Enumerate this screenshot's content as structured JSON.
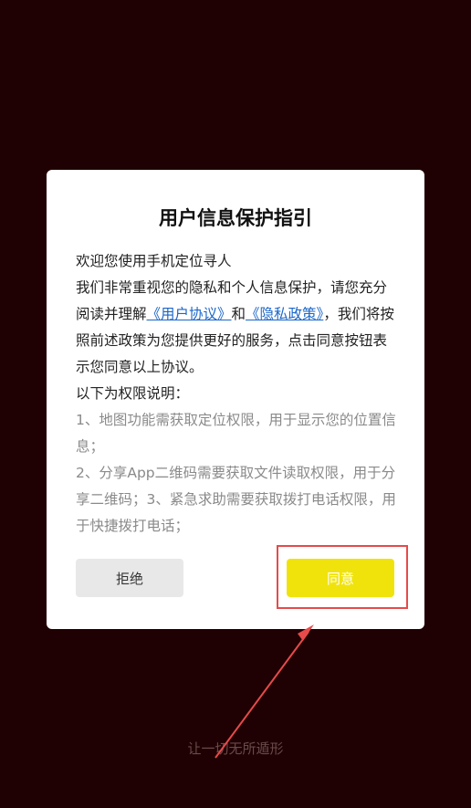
{
  "dialog": {
    "title": "用户信息保护指引",
    "intro": "欢迎您使用手机定位寻人",
    "body_part1": "我们非常重视您的隐私和个人信息保护，请您充分阅读并理解",
    "link_user_agreement": "《用户协议》",
    "and_text": "和",
    "link_privacy_policy": "《隐私政策》",
    "body_part2": "，我们将按照前述政策为您提供更好的服务，点击同意按钮表示您同意以上协议。",
    "permissions_heading": "以下为权限说明：",
    "permission_1": "1、地图功能需获取定位权限，用于显示您的位置信息；",
    "permission_2_3": "2、分享App二维码需要获取文件读取权限，用于分享二维码；3、紧急求助需要获取拨打电话权限，用于快捷拨打电话；",
    "reject_label": "拒绝",
    "agree_label": "同意"
  },
  "slogan": "让一切无所遁形",
  "colors": {
    "background": "#1f0003",
    "agree_button": "#f0e30c",
    "reject_button": "#e8e8e8",
    "link": "#1a66c9",
    "annotation": "#e64a4a"
  }
}
